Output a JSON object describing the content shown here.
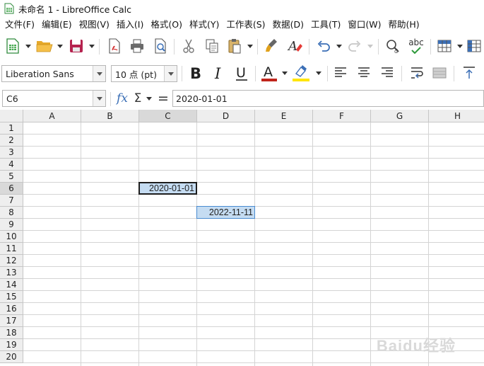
{
  "window": {
    "title": "未命名 1 - LibreOffice Calc"
  },
  "menu": [
    "文件(F)",
    "编辑(E)",
    "视图(V)",
    "插入(I)",
    "格式(O)",
    "样式(Y)",
    "工作表(S)",
    "数据(D)",
    "工具(T)",
    "窗口(W)",
    "帮助(H)"
  ],
  "toolbar": {
    "spell_label": "abc"
  },
  "format_toolbar": {
    "font_name": "Liberation Sans",
    "font_size": "10 点 (pt)",
    "font_color": "#c0241b",
    "highlight_color": "#ffe500"
  },
  "formula_bar": {
    "name_box": "C6",
    "fx_label": "fx",
    "sum_label": "Σ",
    "equals_label": "=",
    "content": "2020-01-01"
  },
  "sheet": {
    "columns": [
      "A",
      "B",
      "C",
      "D",
      "E",
      "F",
      "G",
      "H"
    ],
    "rows": [
      "1",
      "2",
      "3",
      "4",
      "5",
      "6",
      "7",
      "8",
      "9",
      "10",
      "11",
      "12",
      "13",
      "14",
      "15",
      "16",
      "17",
      "18",
      "19",
      "20"
    ],
    "cells": {
      "C6": "2020-01-01",
      "D8": "2022-11-11"
    },
    "active_cell": "C6",
    "selection_color": "#c5dcf2"
  },
  "watermark": "Baidu经验"
}
